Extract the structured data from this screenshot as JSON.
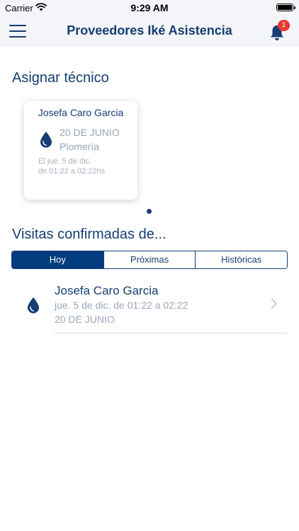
{
  "status_bar": {
    "carrier": "Carrier",
    "time": "9:29 AM"
  },
  "nav": {
    "title": "Proveedores Iké Asistencia",
    "notification_count": "1"
  },
  "assign_section": {
    "title": "Asignar técnico",
    "card": {
      "name": "Josefa Caro Garcia",
      "date": "20 DE JUNIO",
      "service": "Plomería",
      "schedule_line1": "El jue. 5 de dic.",
      "schedule_line2": "de 01:22 a 02:22hs"
    }
  },
  "visits_section": {
    "title": "Visitas confirmadas de...",
    "tabs": [
      {
        "label": "Hoy",
        "active": true
      },
      {
        "label": "Próximas",
        "active": false
      },
      {
        "label": "Históricas",
        "active": false
      }
    ],
    "items": [
      {
        "name": "Josefa Caro Garcia",
        "schedule": "jue. 5 de dic. de 01:22 a 02:22",
        "date": "20 DE JUNIO"
      }
    ]
  },
  "colors": {
    "primary": "#163e72",
    "active_tab": "#003c7e",
    "badge": "#e53935",
    "muted_text": "#9aa6b8"
  },
  "icons": {
    "menu": "hamburger-menu-icon",
    "notifications": "bell-icon",
    "service": "water-drop-icon",
    "disclosure": "chevron-right-icon"
  }
}
